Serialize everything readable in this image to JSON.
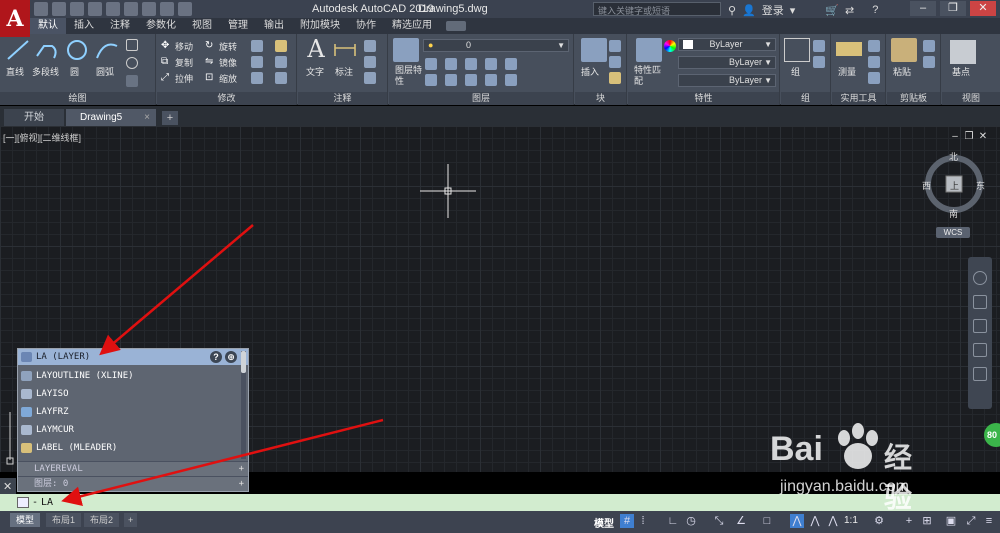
{
  "app": {
    "logo_letter": "A",
    "title": "Autodesk AutoCAD 2019",
    "document": "Drawing5.dwg",
    "search_placeholder": "键入关键字或短语",
    "login_label": "登录",
    "help_label": "?"
  },
  "ribbon_tabs": [
    "默认",
    "插入",
    "注释",
    "参数化",
    "视图",
    "管理",
    "输出",
    "附加模块",
    "协作",
    "精选应用"
  ],
  "ribbon": {
    "draw": {
      "title": "绘图",
      "line": "直线",
      "polyline": "多段线",
      "circle": "圆",
      "arc": "圆弧"
    },
    "modify": {
      "title": "修改",
      "move": "移动",
      "rotate": "旋转",
      "copy": "复制",
      "mirror": "镜像",
      "stretch": "拉伸",
      "scale": "缩放"
    },
    "annotation": {
      "title": "注释",
      "text": "文字",
      "dimension": "标注"
    },
    "layers": {
      "title": "图层",
      "layer_props": "图层特性",
      "current_layer": "0"
    },
    "block": {
      "title": "块",
      "insert": "插入"
    },
    "properties": {
      "title": "特性",
      "match": "特性匹配",
      "color": "ByLayer",
      "linetype": "ByLayer",
      "lineweight": "ByLayer"
    },
    "groups": {
      "title": "组",
      "group": "组"
    },
    "utilities": {
      "title": "实用工具",
      "measure": "测量"
    },
    "clipboard": {
      "title": "剪贴板",
      "paste": "粘贴"
    },
    "view": {
      "title": "视图",
      "base": "基点"
    }
  },
  "file_tabs": [
    {
      "label": "开始"
    },
    {
      "label": "Drawing5",
      "close": "×"
    }
  ],
  "file_tab_add": "+",
  "viewport": {
    "label": "[一][俯视][二维线框]",
    "compass": {
      "north": "北",
      "south": "南",
      "east": "东",
      "west": "西",
      "top": "上"
    },
    "wcs": "WCS"
  },
  "autocomplete": {
    "items": [
      "LA (LAYER)",
      "LAYOUTLINE (XLINE)",
      "LAYISO",
      "LAYFRZ",
      "LAYMCUR",
      "LABEL (MLEADER)"
    ],
    "sections": [
      {
        "label": "LAYEREVAL",
        "expand": "+"
      },
      {
        "label": "图层: 0",
        "expand": "+"
      }
    ],
    "help_icon": "?"
  },
  "command_line": {
    "prompt": "-",
    "input": "LA"
  },
  "layout_tabs": [
    "模型",
    "布局1",
    "布局2"
  ],
  "layout_add": "+",
  "status": {
    "model": "模型",
    "scale": "1:1"
  },
  "badge": "80",
  "watermark": {
    "brand_left": "Bai",
    "brand_right": "经验",
    "url": "jingyan.baidu.com"
  },
  "colors": {
    "accent_red": "#e01010",
    "cmd_bg": "#d2eccf",
    "popup_highlight": "#9ab3d6"
  }
}
